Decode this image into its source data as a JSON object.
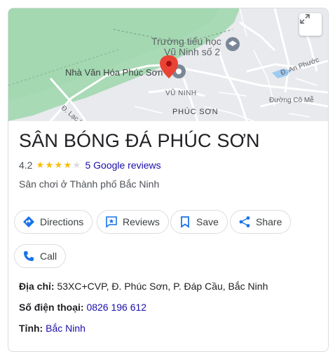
{
  "map": {
    "labels": {
      "school_line1": "Trường tiểu học",
      "school_line2": "Vũ Ninh số 2",
      "culture_house": "Nhà Văn Hóa Phúc Sơn",
      "street_lac_long_quan": "Đ. Lạc Long Quân",
      "street_an_phuoc": "Đ. An Phước",
      "ward_vu_ninh": "VŨ NINH",
      "ward_phuc_son": "PHÚC SƠN",
      "street_co_me": "Đường Cô Mễ"
    },
    "icons": {
      "expand": "expand-icon",
      "pin": "map-pin-icon"
    }
  },
  "place": {
    "title": "SÂN BÓNG ĐÁ PHÚC SƠN",
    "rating": "4.2",
    "stars_filled": 4,
    "stars_total": 5,
    "reviews_link": "5 Google reviews",
    "category": "Sân chơi ở Thành phố Bắc Ninh"
  },
  "actions": {
    "directions": "Directions",
    "reviews": "Reviews",
    "save": "Save",
    "share": "Share",
    "call": "Call"
  },
  "info": {
    "address_label": "Địa chỉ",
    "address_value": "53XC+CVP, Đ. Phúc Sơn, P. Đáp Cầu, Bắc Ninh",
    "phone_label": "Số điện thoại",
    "phone_value": "0826 196 612",
    "province_label": "Tỉnh",
    "province_value": "Bắc Ninh"
  },
  "colors": {
    "accent": "#1a73e8",
    "link": "#1a0dab",
    "star": "#fbbc04",
    "map_green": "#a8dab5",
    "pin_red": "#ea4335"
  }
}
